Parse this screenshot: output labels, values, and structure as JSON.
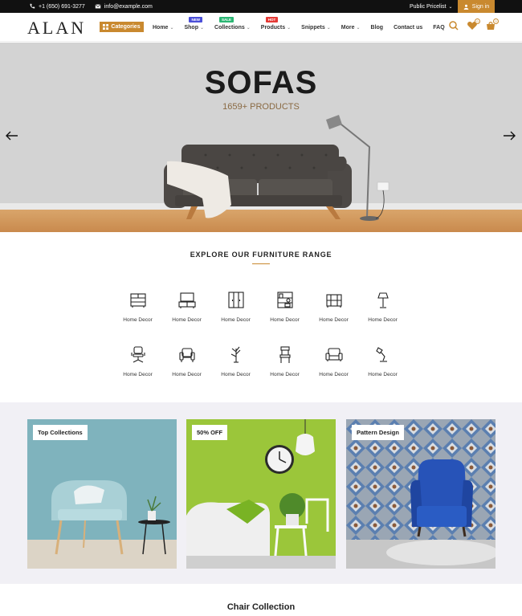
{
  "topbar": {
    "phone": "+1 (650) 691-3277",
    "email": "info@example.com",
    "pricelist": "Public Pricelist",
    "signin": "Sign in"
  },
  "header": {
    "logo": "ALAN",
    "categories": "Categories",
    "nav": [
      {
        "label": "Home",
        "chevron": true,
        "badge": null
      },
      {
        "label": "Shop",
        "chevron": true,
        "badge": "NEW"
      },
      {
        "label": "Collections",
        "chevron": true,
        "badge": "SALE"
      },
      {
        "label": "Products",
        "chevron": true,
        "badge": "HOT"
      },
      {
        "label": "Snippets",
        "chevron": true,
        "badge": null
      },
      {
        "label": "More",
        "chevron": true,
        "badge": null
      },
      {
        "label": "Blog",
        "chevron": false,
        "badge": null
      },
      {
        "label": "Contact us",
        "chevron": false,
        "badge": null
      },
      {
        "label": "FAQ",
        "chevron": false,
        "badge": null
      }
    ],
    "wishlist_count": "0",
    "cart_count": "0",
    "accent": "#c9892f"
  },
  "hero": {
    "title": "SOFAS",
    "subtitle": "1659+ PRODUCTS"
  },
  "range": {
    "title": "EXPLORE OUR FURNITURE RANGE",
    "items": [
      {
        "label": "Home Decor",
        "icon": "cabinet-icon"
      },
      {
        "label": "Home Decor",
        "icon": "tv-stand-icon"
      },
      {
        "label": "Home Decor",
        "icon": "wardrobe-icon"
      },
      {
        "label": "Home Decor",
        "icon": "shelf-icon"
      },
      {
        "label": "Home Decor",
        "icon": "dresser-icon"
      },
      {
        "label": "Home Decor",
        "icon": "floor-lamp-icon"
      },
      {
        "label": "Home Decor",
        "icon": "office-chair-icon"
      },
      {
        "label": "Home Decor",
        "icon": "armchair-icon"
      },
      {
        "label": "Home Decor",
        "icon": "plant-icon"
      },
      {
        "label": "Home Decor",
        "icon": "dining-chair-icon"
      },
      {
        "label": "Home Decor",
        "icon": "sofa-icon"
      },
      {
        "label": "Home Decor",
        "icon": "desk-lamp-icon"
      }
    ]
  },
  "collections": [
    {
      "tag": "Top Collections"
    },
    {
      "tag": "50% OFF"
    },
    {
      "tag": "Pattern Design"
    }
  ],
  "chair_collection": "Chair Collection"
}
